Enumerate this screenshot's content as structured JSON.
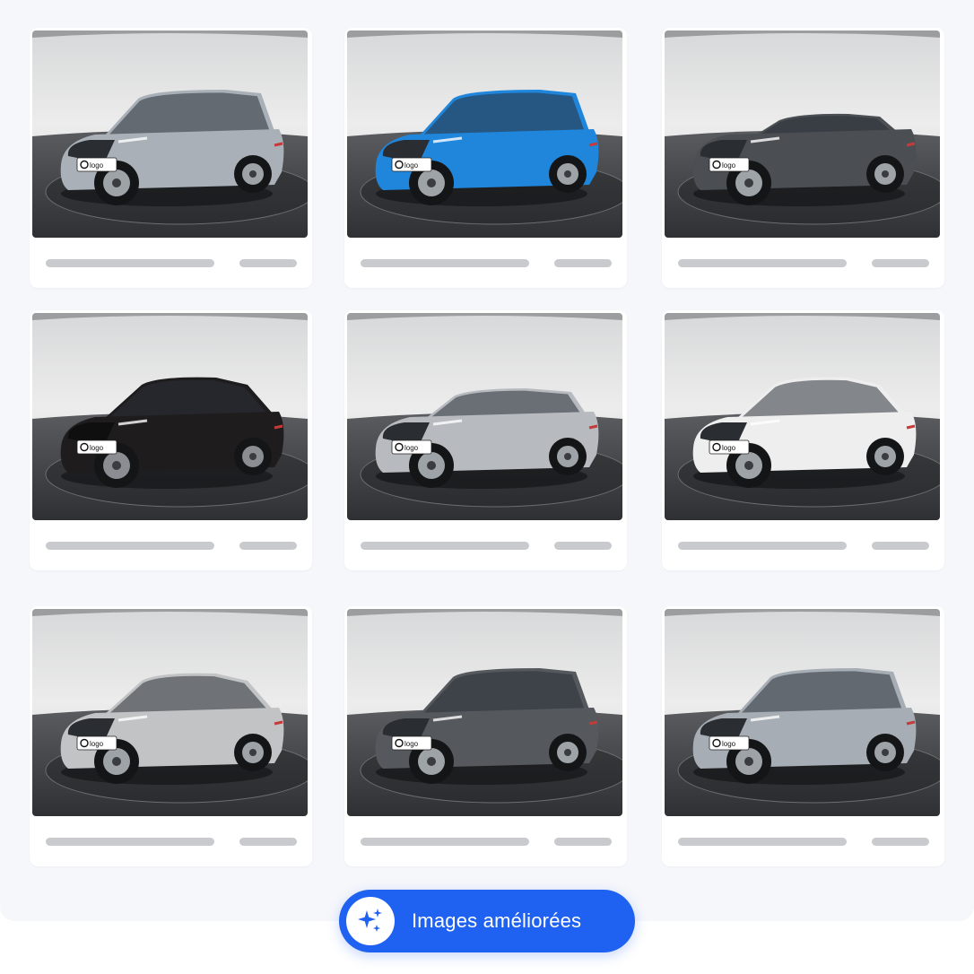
{
  "gallery": {
    "cars": [
      {
        "alt": "",
        "body": "suv",
        "color": "#a9b0b7",
        "plate": "logo"
      },
      {
        "alt": "",
        "body": "suv",
        "color": "#1f86dc",
        "plate": "logo"
      },
      {
        "alt": "",
        "body": "sedan",
        "color": "#4b4f54",
        "plate": "logo"
      },
      {
        "alt": "",
        "body": "coupe-suv",
        "color": "#1e1c1d",
        "plate": "logo"
      },
      {
        "alt": "",
        "body": "hatch",
        "color": "#b7babe",
        "plate": "logo"
      },
      {
        "alt": "",
        "body": "coupe-suv",
        "color": "#eeeeee",
        "plate": "logo"
      },
      {
        "alt": "",
        "body": "coupe-suv",
        "color": "#c2c3c4",
        "plate": "logo"
      },
      {
        "alt": "",
        "body": "suv",
        "color": "#55585d",
        "plate": "logo"
      },
      {
        "alt": "",
        "body": "suv",
        "color": "#a7adb4",
        "plate": "logo"
      }
    ]
  },
  "cta": {
    "label": "Images améliorées",
    "icon": "sparkles-icon",
    "background": "#1f61f0"
  }
}
